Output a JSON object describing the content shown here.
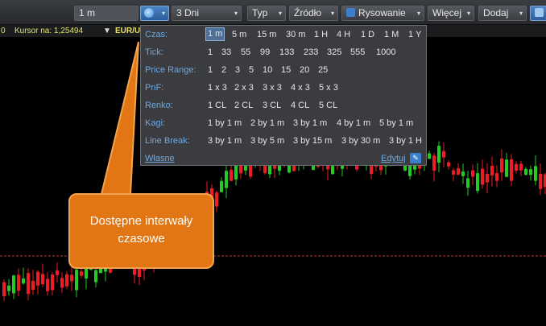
{
  "toolbar": {
    "interval_value": "1 m",
    "range_value": "3 Dni",
    "type_label": "Typ",
    "source_label": "Źródło",
    "drawing_label": "Rysowanie",
    "more_label": "Więcej",
    "add_label": "Dodaj"
  },
  "subbar": {
    "price_prefix": "0",
    "cursor_text": "Kursor na: 1,25494",
    "symbol": "EUR/U"
  },
  "panel": {
    "czas": {
      "label": "Czas:",
      "values": [
        "1 m",
        "5 m",
        "15 m",
        "30 m",
        "1 H",
        "4 H",
        "1 D",
        "1 M",
        "1 Y"
      ]
    },
    "tick": {
      "label": "Tick:",
      "values": [
        "1",
        "33",
        "55",
        "99",
        "133",
        "233",
        "325",
        "555",
        "1000"
      ]
    },
    "price_range": {
      "label": "Price Range:",
      "values": [
        "1",
        "2",
        "3",
        "5",
        "10",
        "15",
        "20",
        "25"
      ]
    },
    "pnf": {
      "label": "PnF:",
      "values": [
        "1 x 3",
        "2 x 3",
        "3 x 3",
        "4 x 3",
        "5 x 3"
      ]
    },
    "renko": {
      "label": "Renko:",
      "values": [
        "1 CL",
        "2 CL",
        "3 CL",
        "4 CL",
        "5 CL"
      ]
    },
    "kagi": {
      "label": "Kagi:",
      "values": [
        "1 by 1 m",
        "2 by 1 m",
        "3 by 1 m",
        "4 by 1 m",
        "5 by 1 m"
      ]
    },
    "line_break": {
      "label": "Line Break:",
      "values": [
        "3 by 1 m",
        "3 by 5 m",
        "3 by 15 m",
        "3 by 30 m",
        "3 by 1 H"
      ]
    },
    "custom_link": "Własne",
    "edit_link": "Edytuj"
  },
  "callout": {
    "line1": "Dostępne interwały",
    "line2": "czasowe"
  },
  "colors": {
    "bull": "#22cc22",
    "bear": "#ee1c24",
    "accent": "#3c7fcc",
    "callout": "#e37614"
  }
}
